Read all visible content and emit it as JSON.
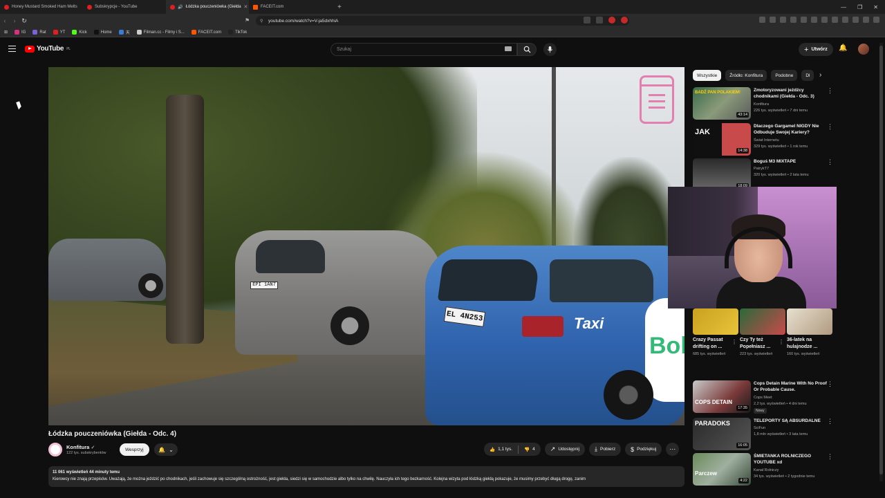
{
  "browser": {
    "tabs": [
      {
        "title": "Honey Mustard Smoked Ham Melts",
        "active": false
      },
      {
        "title": "Subskrypcje - YouTube",
        "active": false
      },
      {
        "title": "Łódzka pouczeniówka (Giełda",
        "active": true
      },
      {
        "title": "FACEIT.com",
        "active": false
      }
    ],
    "url": "youtube.com/watch?v=V-ja5dxhhiA",
    "bookmarks": [
      "IG",
      "Rat",
      "YT",
      "Kick",
      "Home",
      "天",
      "Filman.cc - Filmy i S...",
      "FACEIT.com",
      "TikTok"
    ]
  },
  "header": {
    "logo_text": "YouTube",
    "logo_region": "PL",
    "search_placeholder": "Szukaj",
    "create_label": "Utwórz"
  },
  "video": {
    "title": "Łódzka pouczeniówka (Giełda - Odc. 4)",
    "plate_silver": "EPI 1AN7",
    "plate_taxi": "EL 4N253",
    "taxi_text": "Taxi",
    "bolt_text": "Bol",
    "channel": {
      "name": "Konfitura",
      "subscribers": "122 tys. subskrybentów",
      "support_label": "Wesprzyj"
    },
    "actions": {
      "likes": "1,1 tys.",
      "dislikes": "4",
      "share": "Udostępnij",
      "download": "Pobierz",
      "thanks": "Podziękuj"
    },
    "description": {
      "meta": "11 061 wyświetleń  44 minuty temu",
      "text": "Kierowcy nie znają przepisów. Uważają, że można jeździć po chodnikach, jeśli zachowuje się szczególną ostrożność, jest giełda, siedzi się w samochodzie albo tylko na chwilę. Nauczyła ich tego bezkarność. Kolejna wizyta pod łódzką giełdą pokazuje, że musimy przebyć długą drogę, zanim"
    }
  },
  "sidebar": {
    "chips": [
      "Wszystkie",
      "Źródło: Konfitura",
      "Podobne",
      "Dl"
    ],
    "recommendations": [
      {
        "title": "Zmotoryzowani jeźdźcy chodnikami (Giełda - Odc. 3)",
        "channel": "Konfitura",
        "meta": "226 tys. wyświetleń • 7 dni temu",
        "duration": "43:14",
        "overlay": "BADŹ PAN POLAKIEM!"
      },
      {
        "title": "Dlaczego Gargamel NIGDY Nie Odbuduje Swojej Kariery?",
        "channel": "Świat Internetu",
        "meta": "329 tys. wyświetleń • 1 rok temu",
        "duration": "14:38",
        "overlay": "JAK"
      },
      {
        "title": "Boguś M3 MIXTAPE",
        "channel": "PatrykT7",
        "meta": "320 tys. wyświetleń • 2 lata temu",
        "duration": "18:09",
        "overlay": ""
      }
    ],
    "shorts": [
      {
        "title": "Crazy Passat drifting on ...",
        "views": "685 tys. wyświetleń"
      },
      {
        "title": "Czy Ty też Popełniasz ...",
        "views": "223 tys. wyświetleń"
      },
      {
        "title": "36-latek na hulajnodze ...",
        "views": "160 tys. wyświetleń"
      }
    ],
    "recommendations2": [
      {
        "title": "Cops Detain Marine With No Proof Or Probable Cause.",
        "channel": "Cops Meet",
        "meta": "2,2 tys. wyświetleń • 4 dni temu",
        "badge": "Nowy",
        "duration": "17:35",
        "overlay": "COPS DETAIN"
      },
      {
        "title": "TELEPORTY SĄ ABSURDALNE",
        "channel": "SciFun",
        "meta": "1,8 mln wyświetleń • 3 lata temu",
        "duration": "16:05",
        "overlay": "PARADOKS"
      },
      {
        "title": "ŚMIETANKA ROLNICZEGO YOUTUBE xd",
        "channel": "Kanał Rolniczy",
        "meta": "34 tys. wyświetleń • 2 tygodnie temu",
        "duration": "4:22",
        "overlay": "Parczew"
      }
    ]
  }
}
